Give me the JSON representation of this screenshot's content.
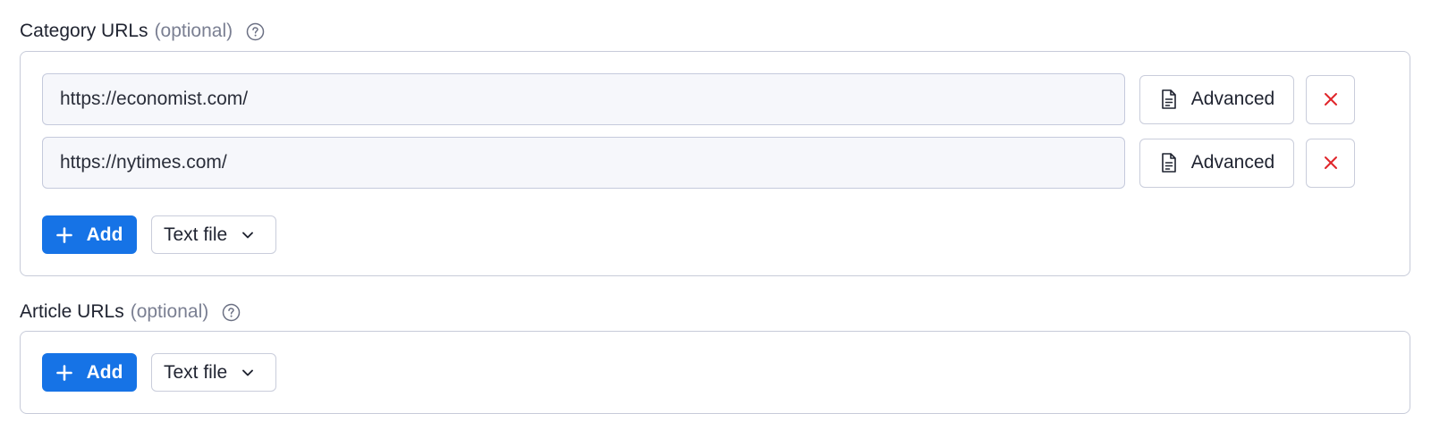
{
  "category_urls": {
    "title": "Category URLs",
    "optional": "(optional)",
    "help_icon": "question-circle-icon",
    "rows": [
      {
        "url": "https://economist.com/",
        "advanced_label": "Advanced"
      },
      {
        "url": "https://nytimes.com/",
        "advanced_label": "Advanced"
      }
    ],
    "add_label": "Add",
    "select_value": "Text file"
  },
  "article_urls": {
    "title": "Article URLs",
    "optional": "(optional)",
    "help_icon": "question-circle-icon",
    "add_label": "Add",
    "select_value": "Text file"
  },
  "colors": {
    "accent": "#1673e6",
    "danger": "#e0262b",
    "border": "#c7cbd9",
    "muted_text": "#7a7f92"
  }
}
